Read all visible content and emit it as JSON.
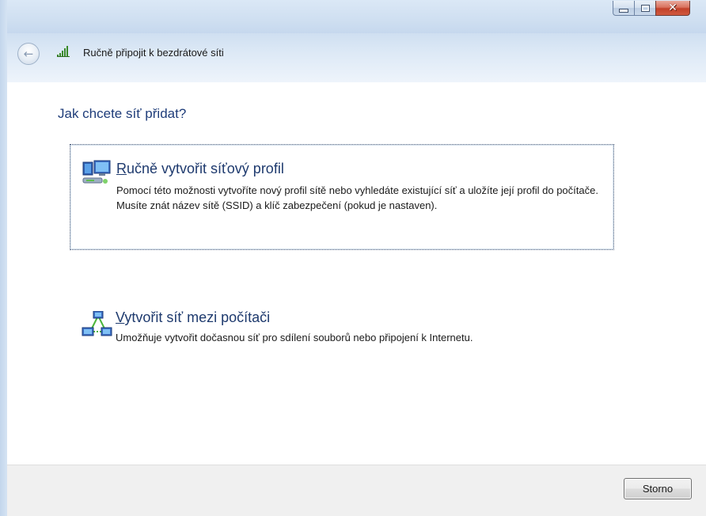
{
  "window": {
    "title": "Ručně připojit k bezdrátové síti",
    "caption": {
      "minimize_icon": "minimize-icon",
      "maximize_icon": "maximize-icon",
      "close_icon": "close-icon",
      "close_glyph": "✕"
    }
  },
  "nav": {
    "back_glyph": "←",
    "title": "Ručně připojit k bezdrátové síti",
    "signal_icon": "wireless-signal-icon"
  },
  "main": {
    "heading": "Jak chcete síť přidat?",
    "options": [
      {
        "title_hotkey": "R",
        "title_rest": "učně vytvořit síťový profil",
        "description": "Pomocí této možnosti vytvoříte nový profil sítě nebo vyhledáte existující síť a uložíte její profil do počítače. Musíte znát název sítě (SSID) a klíč zabezpečení (pokud je nastaven).",
        "icon": "network-profile-icon"
      },
      {
        "title_hotkey": "V",
        "title_rest": "ytvořit síť mezi počítači",
        "description": "Umožňuje vytvořit dočasnou síť pro sdílení souborů nebo připojení k Internetu.",
        "icon": "ad-hoc-network-icon"
      }
    ]
  },
  "footer": {
    "cancel_label": "Storno"
  },
  "colors": {
    "heading": "#1f3d7a",
    "option_title": "#1e3a6e",
    "close_button": "#c2412a"
  }
}
